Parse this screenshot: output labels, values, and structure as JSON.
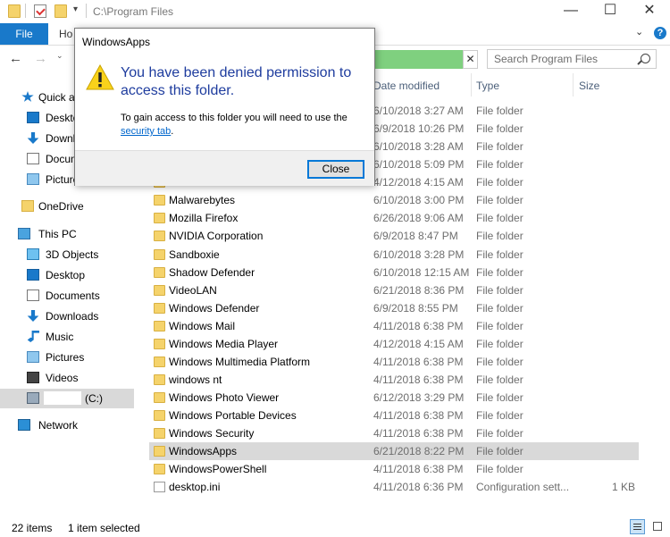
{
  "titlebar": {
    "path": "C:\\Program Files",
    "minimize": "—",
    "maximize": "☐",
    "close": "✕"
  },
  "ribbon": {
    "file": "File",
    "home": "Ho",
    "toggle": "⌄",
    "help": "?"
  },
  "nav": {
    "back": "←",
    "forward": "→",
    "history": "⌄",
    "address_clear": "✕"
  },
  "search": {
    "placeholder": "Search Program Files"
  },
  "sidebar": {
    "items": [
      {
        "label": "Quick ac",
        "icon": "star-icon"
      },
      {
        "label": "Deskto",
        "icon": "desktop-icon"
      },
      {
        "label": "Downl",
        "icon": "download-icon"
      },
      {
        "label": "Docum",
        "icon": "document-icon"
      },
      {
        "label": "Picture",
        "icon": "pictures-icon"
      },
      {
        "label": "OneDrive",
        "icon": "folder-icon"
      },
      {
        "label": "This PC",
        "icon": "computer-icon"
      },
      {
        "label": "3D Objects",
        "icon": "3d-objects-icon"
      },
      {
        "label": "Desktop",
        "icon": "desktop-icon"
      },
      {
        "label": "Documents",
        "icon": "document-icon"
      },
      {
        "label": "Downloads",
        "icon": "download-icon"
      },
      {
        "label": "Music",
        "icon": "music-icon"
      },
      {
        "label": "Pictures",
        "icon": "pictures-icon"
      },
      {
        "label": "Videos",
        "icon": "videos-icon"
      },
      {
        "label": "(C:)",
        "icon": "drive-icon"
      },
      {
        "label": "Network",
        "icon": "network-icon"
      }
    ]
  },
  "columns": {
    "date": "Date modified",
    "type": "Type",
    "size": "Size"
  },
  "files": [
    {
      "name": "",
      "date": "6/10/2018 3:27 AM",
      "type": "File folder",
      "size": ""
    },
    {
      "name": "",
      "date": "6/9/2018 10:26 PM",
      "type": "File folder",
      "size": ""
    },
    {
      "name": "",
      "date": "6/10/2018 3:28 AM",
      "type": "File folder",
      "size": ""
    },
    {
      "name": "",
      "date": "6/10/2018 5:09 PM",
      "type": "File folder",
      "size": ""
    },
    {
      "name": "",
      "date": "4/12/2018 4:15 AM",
      "type": "File folder",
      "size": ""
    },
    {
      "name": "Malwarebytes",
      "date": "6/10/2018 3:00 PM",
      "type": "File folder",
      "size": ""
    },
    {
      "name": "Mozilla Firefox",
      "date": "6/26/2018 9:06 AM",
      "type": "File folder",
      "size": ""
    },
    {
      "name": "NVIDIA Corporation",
      "date": "6/9/2018 8:47 PM",
      "type": "File folder",
      "size": ""
    },
    {
      "name": "Sandboxie",
      "date": "6/10/2018 3:28 PM",
      "type": "File folder",
      "size": ""
    },
    {
      "name": "Shadow Defender",
      "date": "6/10/2018 12:15 AM",
      "type": "File folder",
      "size": ""
    },
    {
      "name": "VideoLAN",
      "date": "6/21/2018 8:36 PM",
      "type": "File folder",
      "size": ""
    },
    {
      "name": "Windows Defender",
      "date": "6/9/2018 8:55 PM",
      "type": "File folder",
      "size": ""
    },
    {
      "name": "Windows Mail",
      "date": "4/11/2018 6:38 PM",
      "type": "File folder",
      "size": ""
    },
    {
      "name": "Windows Media Player",
      "date": "4/12/2018 4:15 AM",
      "type": "File folder",
      "size": ""
    },
    {
      "name": "Windows Multimedia Platform",
      "date": "4/11/2018 6:38 PM",
      "type": "File folder",
      "size": ""
    },
    {
      "name": "windows nt",
      "date": "4/11/2018 6:38 PM",
      "type": "File folder",
      "size": ""
    },
    {
      "name": "Windows Photo Viewer",
      "date": "6/12/2018 3:29 PM",
      "type": "File folder",
      "size": ""
    },
    {
      "name": "Windows Portable Devices",
      "date": "4/11/2018 6:38 PM",
      "type": "File folder",
      "size": ""
    },
    {
      "name": "Windows Security",
      "date": "4/11/2018 6:38 PM",
      "type": "File folder",
      "size": ""
    },
    {
      "name": "WindowsApps",
      "date": "6/21/2018 8:22 PM",
      "type": "File folder",
      "size": "",
      "selected": true
    },
    {
      "name": "WindowsPowerShell",
      "date": "4/11/2018 6:38 PM",
      "type": "File folder",
      "size": ""
    },
    {
      "name": "desktop.ini",
      "date": "4/11/2018 6:36 PM",
      "type": "Configuration sett...",
      "size": "1 KB",
      "is_file": true
    }
  ],
  "status": {
    "items": "22 items",
    "selected": "1 item selected"
  },
  "dialog": {
    "title": "WindowsApps",
    "heading": "You have been denied permission to access this folder.",
    "body": "To gain access to this folder you will need to use the",
    "link": "security tab",
    "link_suffix": ".",
    "close_button": "Close"
  },
  "colors": {
    "accent": "#1979ca",
    "selection": "#d9d9d9",
    "dialog_heading": "#1e3c9e",
    "folder": "#f5d36b"
  }
}
